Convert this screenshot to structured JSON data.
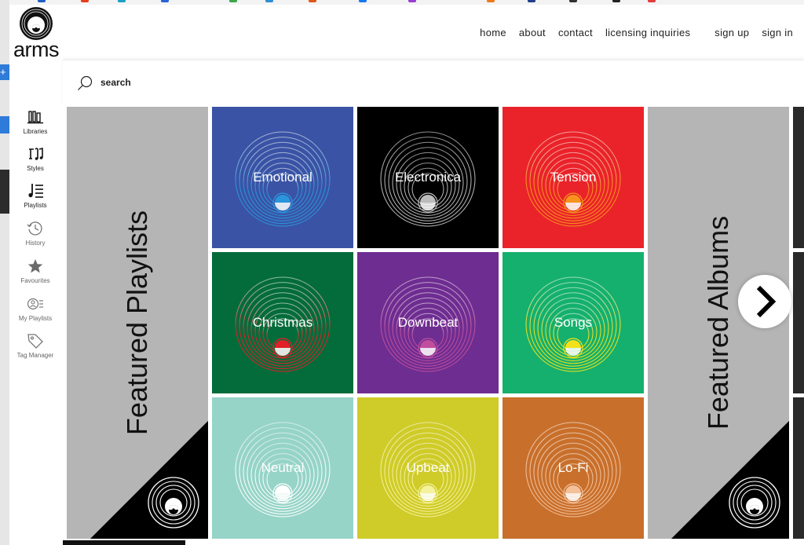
{
  "brand": {
    "name": "arms"
  },
  "nav": {
    "items": [
      {
        "label": "home"
      },
      {
        "label": "about"
      },
      {
        "label": "contact"
      },
      {
        "label": "licensing inquiries"
      },
      {
        "label": "sign up"
      },
      {
        "label": "sign in"
      }
    ]
  },
  "search": {
    "label": "search"
  },
  "sidebar": {
    "items": [
      {
        "label": "Libraries",
        "icon": "libraries-icon"
      },
      {
        "label": "Styles",
        "icon": "styles-icon"
      },
      {
        "label": "Playlists",
        "icon": "playlists-icon"
      },
      {
        "label": "History",
        "icon": "history-icon"
      },
      {
        "label": "Favourites",
        "icon": "star-icon"
      },
      {
        "label": "My Playlists",
        "icon": "my-playlists-icon"
      },
      {
        "label": "Tag Manager",
        "icon": "tag-icon"
      }
    ]
  },
  "sections": {
    "featured_playlists": "Featured Playlists",
    "featured_albums": "Featured Albums"
  },
  "playlists": [
    {
      "label": "Emotional",
      "bg": "#3a53a4",
      "ring": "#2a95dc"
    },
    {
      "label": "Electronica",
      "bg": "#000000",
      "ring": "#bbbbbb"
    },
    {
      "label": "Tension",
      "bg": "#ea2229",
      "ring": "#f7941d"
    },
    {
      "label": "Christmas",
      "bg": "#046b3a",
      "ring": "#e21f26"
    },
    {
      "label": "Downbeat",
      "bg": "#6e2d90",
      "ring": "#c14d9e"
    },
    {
      "label": "Songs",
      "bg": "#15b06e",
      "ring": "#f3e21a"
    },
    {
      "label": "Neutral",
      "bg": "#96d4c8",
      "ring": "#ffffff"
    },
    {
      "label": "Upbeat",
      "bg": "#cfcc29",
      "ring": "#f5f29c"
    },
    {
      "label": "Lo-Fi",
      "bg": "#c8702b",
      "ring": "#f4c09a"
    }
  ],
  "colors": {
    "panel_gray": "#b5b5b5"
  }
}
